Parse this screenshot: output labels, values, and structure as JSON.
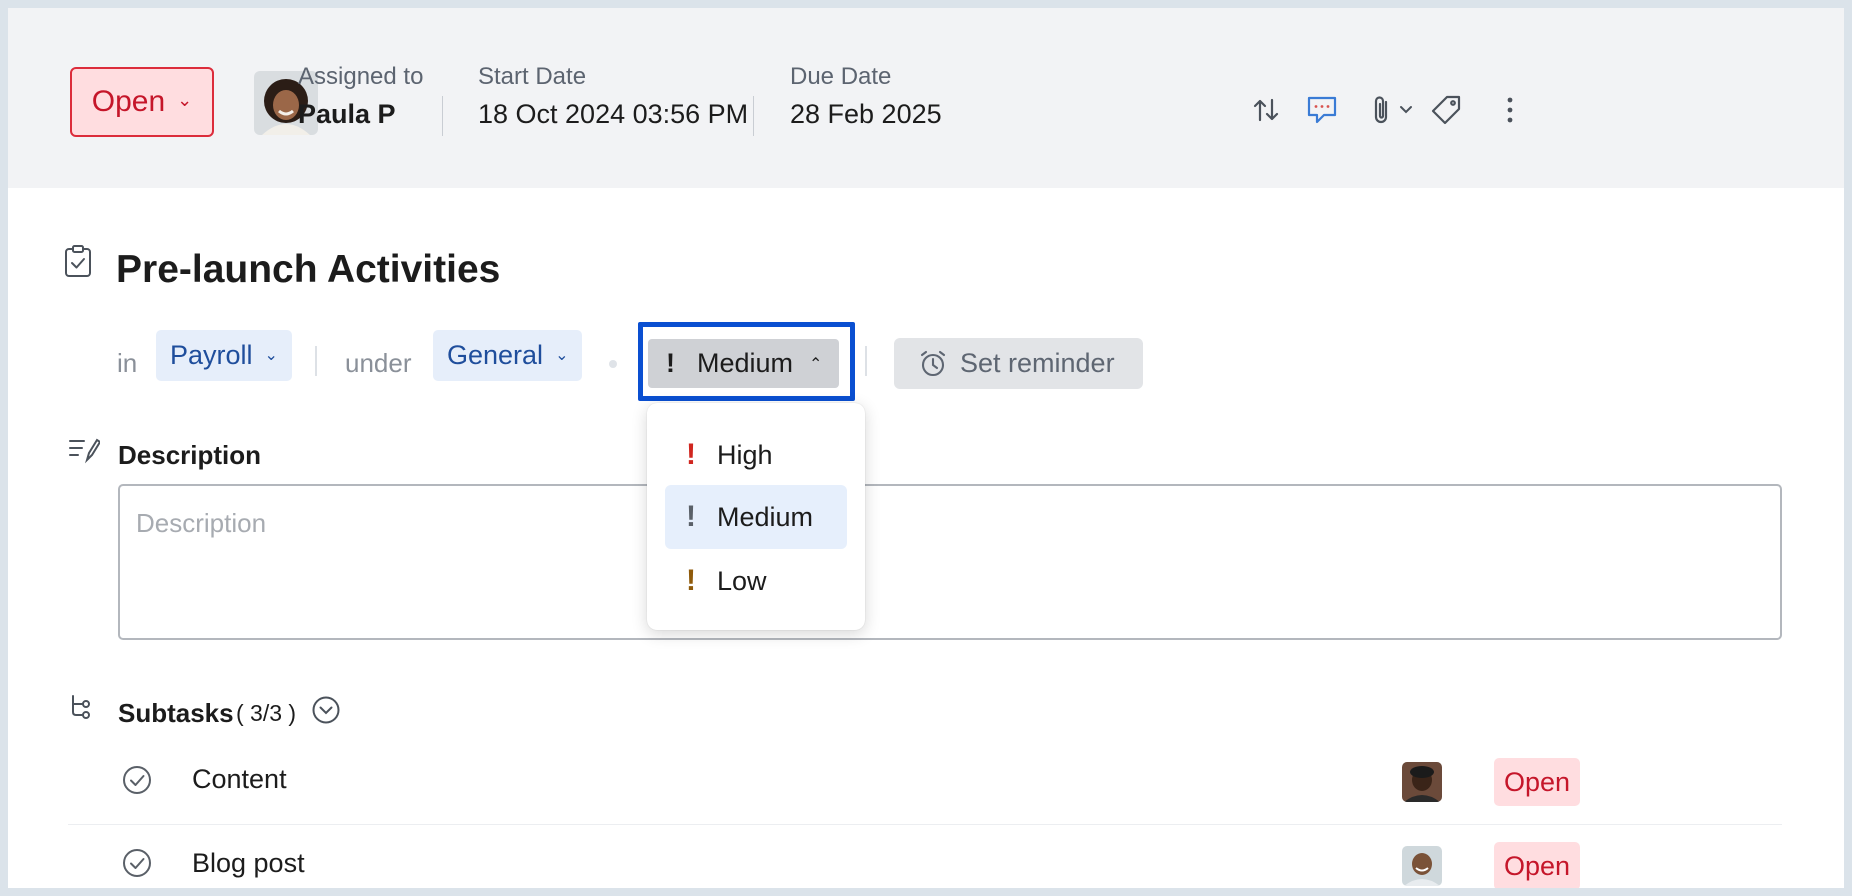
{
  "header": {
    "status": "Open",
    "assigned_label": "Assigned to",
    "assignee": "Paula P",
    "start_label": "Start Date",
    "start_date": "18 Oct 2024 03:56 PM",
    "due_label": "Due Date",
    "due_date": "28 Feb 2025",
    "actions": [
      "convert-icon",
      "comment-icon",
      "attachment-icon",
      "tag-icon",
      "more-icon"
    ]
  },
  "task": {
    "title": "Pre-launch Activities",
    "in_word": "in",
    "list": "Payroll",
    "under_word": "under",
    "group": "General",
    "priority": "Medium",
    "reminder_label": "Set reminder"
  },
  "priority_menu": [
    {
      "label": "High",
      "color": "#d0261f"
    },
    {
      "label": "Medium",
      "color": "#5a6068",
      "selected": true
    },
    {
      "label": "Low",
      "color": "#8f5a0a"
    }
  ],
  "description": {
    "label": "Description",
    "placeholder": "Description"
  },
  "subtasks": {
    "label": "Subtasks",
    "count": "( 3/3 )",
    "items": [
      {
        "name": "Content",
        "status": "Open"
      },
      {
        "name": "Blog post",
        "status": "Open"
      }
    ]
  },
  "colors": {
    "accent": "#0a4fd1",
    "open_bg": "#ffdde0",
    "open_text": "#c5162a",
    "pill_bg": "#e6eefa",
    "pill_text": "#1f4e9c"
  }
}
